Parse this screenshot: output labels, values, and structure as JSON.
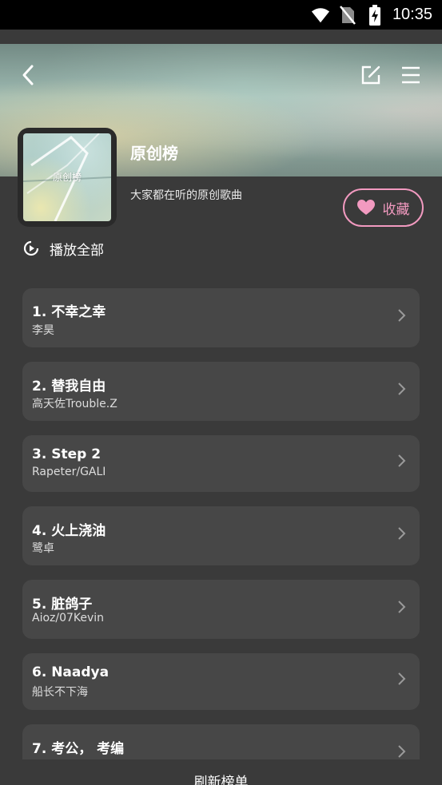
{
  "status_bar": {
    "time": "10:35"
  },
  "header": {
    "title": "原创榜",
    "subtitle": "大家都在听的原创歌曲",
    "cover_label": "原创榜"
  },
  "actions": {
    "collect_label": "收藏",
    "play_all_label": "播放全部",
    "refresh_label": "刷新榜单"
  },
  "colors": {
    "accent": "#f29ac0",
    "card_bg": "#474747",
    "page_bg": "#3a3a3a"
  },
  "songs": [
    {
      "title": "1. 不幸之幸",
      "artist": "李昊"
    },
    {
      "title": "2. 替我自由",
      "artist": "高天佐Trouble.Z"
    },
    {
      "title": "3. Step 2",
      "artist": "Rapeter/GALI"
    },
    {
      "title": "4. 火上浇油",
      "artist": "鹭卓"
    },
    {
      "title": "5. 脏鸽子",
      "artist": "Aioz/07Kevin"
    },
    {
      "title": "6. Naadya",
      "artist": "船长不下海"
    },
    {
      "title": "7. 考公， 考编",
      "artist": ""
    }
  ]
}
